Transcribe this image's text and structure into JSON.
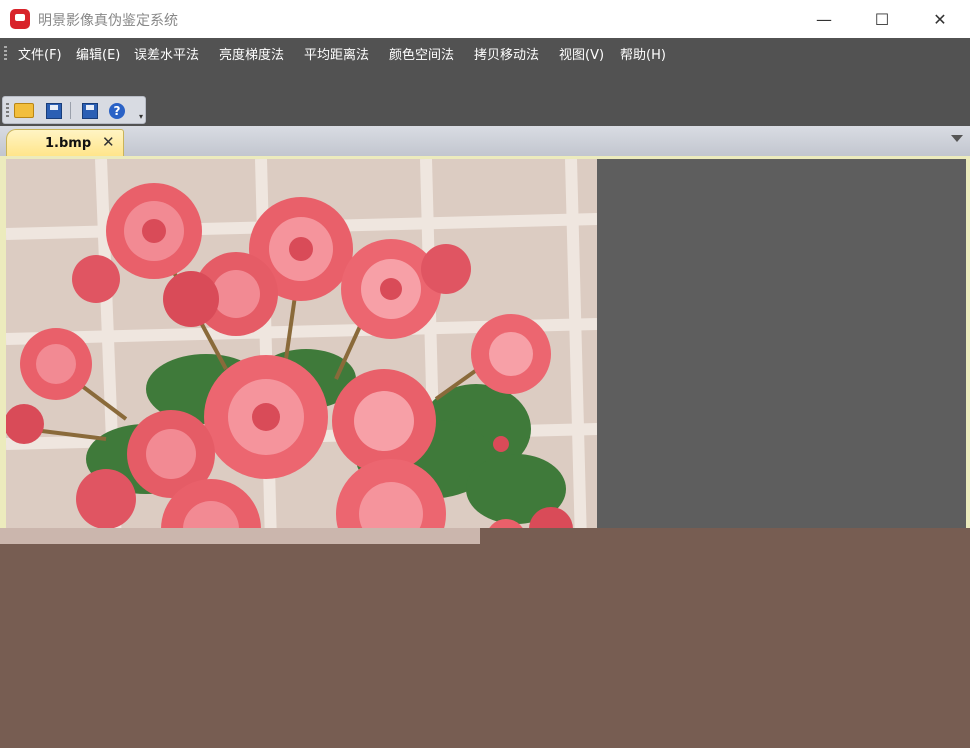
{
  "window": {
    "title": "明景影像真伪鉴定系统"
  },
  "window_controls": {
    "minimize": "—",
    "maximize": "☐",
    "close": "✕"
  },
  "menu": {
    "items": [
      {
        "label": "文件(F)"
      },
      {
        "label": "编辑(E)"
      },
      {
        "label": "误差水平法"
      },
      {
        "label": "亮度梯度法"
      },
      {
        "label": "平均距离法"
      },
      {
        "label": "颜色空间法"
      },
      {
        "label": "拷贝移动法"
      },
      {
        "label": "视图(V)"
      },
      {
        "label": "帮助(H)"
      }
    ]
  },
  "toolbar": {
    "buttons": [
      {
        "icon": "open-folder-icon"
      },
      {
        "icon": "save-icon"
      },
      {
        "icon": "save-as-icon"
      },
      {
        "icon": "help-icon"
      }
    ]
  },
  "tabs": [
    {
      "label": "1.bmp",
      "close": "✕"
    }
  ],
  "colors": {
    "menubar": "#525252",
    "tab_active": "#ffe58a",
    "canvas": "#5e5e5e",
    "background": "#775d52"
  },
  "document": {
    "image": "pink-begonia-flowers-photo"
  }
}
